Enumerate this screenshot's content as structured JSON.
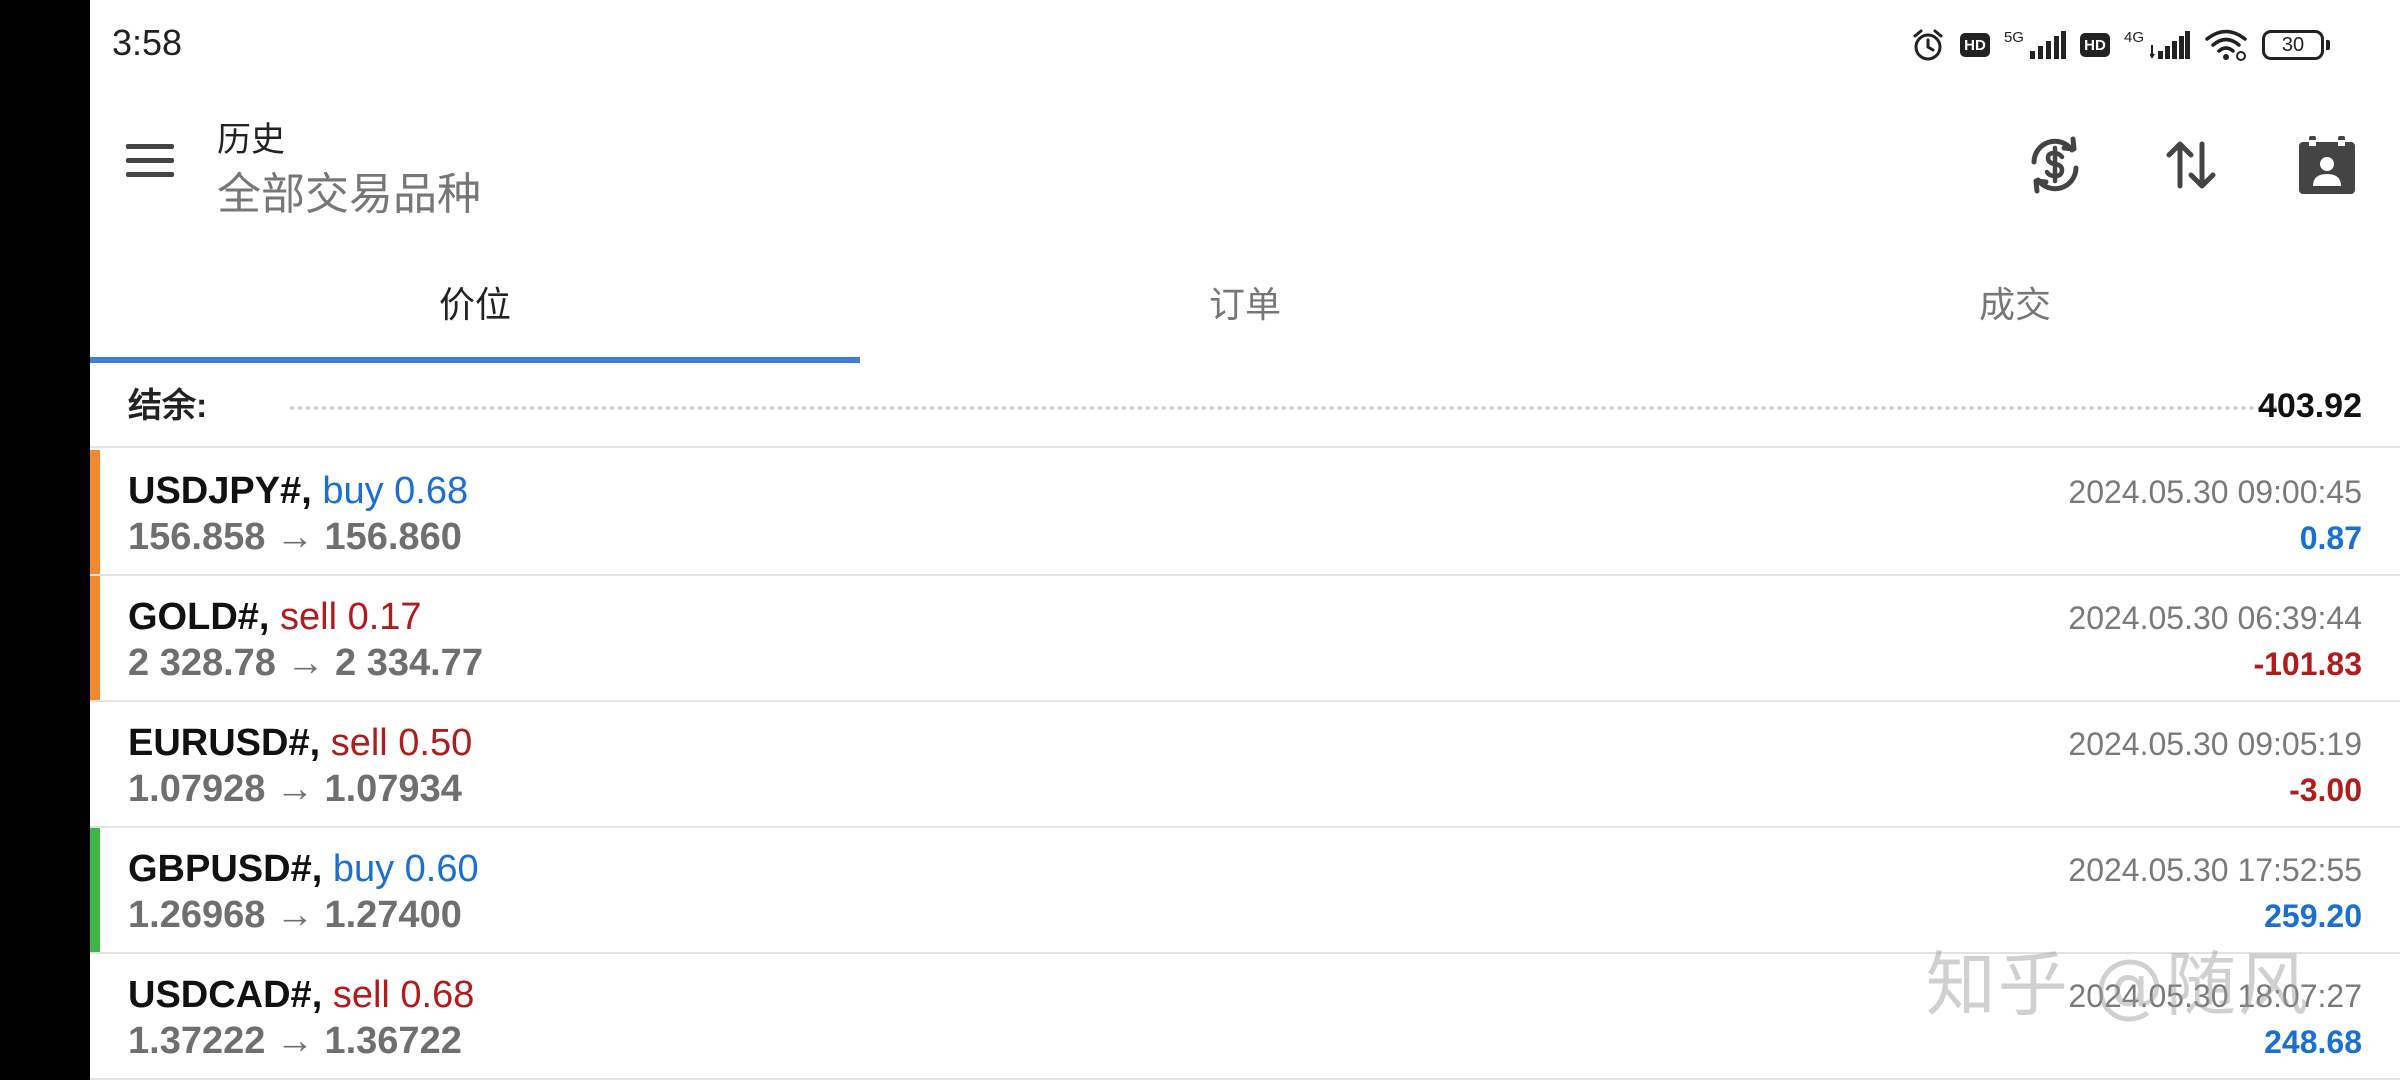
{
  "status_bar": {
    "time": "3:58",
    "icons": [
      "alarm-icon",
      "hd-icon",
      "signal-5g-icon",
      "hd-icon",
      "signal-4g-icon",
      "wifi-icon",
      "battery-icon"
    ],
    "hd_label": "HD",
    "net1": "5G",
    "net2": "4G",
    "battery": "30"
  },
  "toolbar": {
    "title": "历史",
    "subtitle": "全部交易品种",
    "actions": [
      "currency-sync-icon",
      "sort-icon",
      "calendar-contact-icon"
    ]
  },
  "tabs": [
    {
      "label": "价位",
      "active": true
    },
    {
      "label": "订单",
      "active": false
    },
    {
      "label": "成交",
      "active": false
    }
  ],
  "balance": {
    "label": "结余:",
    "value": "403.92"
  },
  "colors": {
    "accent": "#3f7fd8",
    "buy": "#1a6fd1",
    "sell": "#b01c1c",
    "marker_orange": "#f08a2c",
    "marker_green": "#3fb54c"
  },
  "positions": [
    {
      "symbol": "USDJPY#,",
      "type": "buy 0.68",
      "side": "buy",
      "prices": "156.858 → 156.860",
      "time": "2024.05.30 09:00:45",
      "profit": "0.87",
      "marker": "orange"
    },
    {
      "symbol": "GOLD#,",
      "type": "sell 0.17",
      "side": "sell",
      "prices": "2 328.78 → 2 334.77",
      "time": "2024.05.30 06:39:44",
      "profit": "-101.83",
      "marker": "orange"
    },
    {
      "symbol": "EURUSD#,",
      "type": "sell 0.50",
      "side": "sell",
      "prices": "1.07928 → 1.07934",
      "time": "2024.05.30 09:05:19",
      "profit": "-3.00",
      "marker": "none"
    },
    {
      "symbol": "GBPUSD#,",
      "type": "buy 0.60",
      "side": "buy",
      "prices": "1.26968 → 1.27400",
      "time": "2024.05.30 17:52:55",
      "profit": "259.20",
      "marker": "green"
    },
    {
      "symbol": "USDCAD#,",
      "type": "sell 0.68",
      "side": "sell",
      "prices": "1.37222 → 1.36722",
      "time": "2024.05.30 18:07:27",
      "profit": "248.68",
      "marker": "none"
    }
  ],
  "watermark": "知乎 @随风"
}
